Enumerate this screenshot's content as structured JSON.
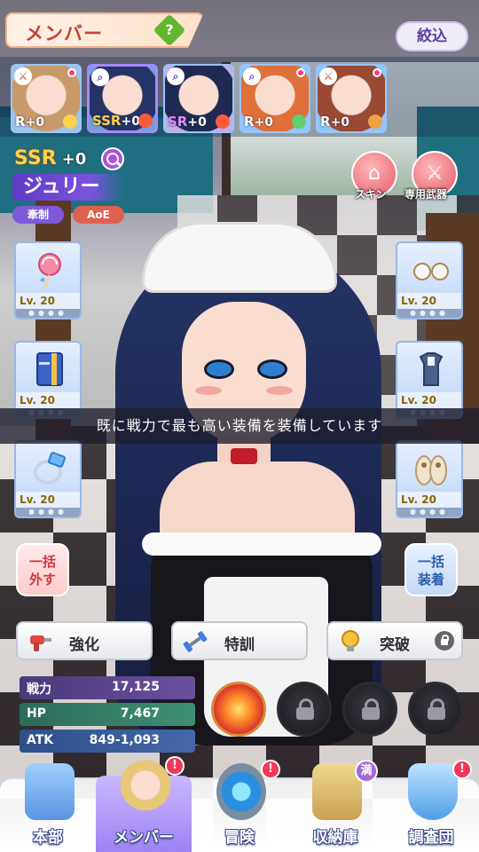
{
  "header": {
    "title": "メンバー",
    "help": "?",
    "filter_label": "絞込"
  },
  "roster": [
    {
      "class_icon": "sword-icon",
      "rarity": "R",
      "plus": "+0",
      "element": "star",
      "selected": false,
      "has_dot": true
    },
    {
      "class_icon": "magnifier-icon",
      "rarity": "SSR",
      "plus": "+0",
      "element": "fire",
      "selected": true,
      "has_dot": false
    },
    {
      "class_icon": "magnifier-icon",
      "rarity": "SR",
      "plus": "+0",
      "element": "fire",
      "selected": false,
      "has_dot": false
    },
    {
      "class_icon": "magnifier-icon",
      "rarity": "R",
      "plus": "+0",
      "element": "wind",
      "selected": false,
      "has_dot": true
    },
    {
      "class_icon": "sword-icon",
      "rarity": "R",
      "plus": "+0",
      "element": "earth",
      "selected": false,
      "has_dot": true
    }
  ],
  "character": {
    "rarity": "SSR",
    "plus": "+0",
    "name": "ジュリー",
    "tags": [
      "牽制",
      "AoE"
    ]
  },
  "side_buttons": {
    "skin": "スキン",
    "weapon": "専用武器"
  },
  "equipment": {
    "left": [
      {
        "icon": "lollipop-icon",
        "level": "Lv. 20"
      },
      {
        "icon": "book-icon",
        "level": "Lv. 20"
      },
      {
        "icon": "ring-icon",
        "level": "Lv. 20"
      }
    ],
    "right": [
      {
        "icon": "glasses-icon",
        "level": "Lv. 20"
      },
      {
        "icon": "clothes-icon",
        "level": "Lv. 20"
      },
      {
        "icon": "sandals-icon",
        "level": "Lv. 20"
      }
    ],
    "pips": "●●●●"
  },
  "toast": "既に戦力で最も高い装備を装備しています",
  "bulk": {
    "unequip_line1": "一括",
    "unequip_line2": "外す",
    "equip_line1": "一括",
    "equip_line2": "装着"
  },
  "actions": {
    "enhance": "強化",
    "train": "特訓",
    "breakthrough": "突破"
  },
  "stats": [
    {
      "key": "戦力",
      "value": "17,125"
    },
    {
      "key": "HP",
      "value": "7,467"
    },
    {
      "key": "ATK",
      "value": "849-1,093"
    }
  ],
  "nav": [
    {
      "label": "本部",
      "badge": ""
    },
    {
      "label": "メンバー",
      "badge": "!"
    },
    {
      "label": "冒険",
      "badge": "!"
    },
    {
      "label": "収納庫",
      "badge": "満"
    },
    {
      "label": "調査団",
      "badge": "!"
    }
  ],
  "colors": {
    "accent_purple": "#7b52e0",
    "ssr_gold": "#ffd24d",
    "badge_red": "#f0385a"
  }
}
